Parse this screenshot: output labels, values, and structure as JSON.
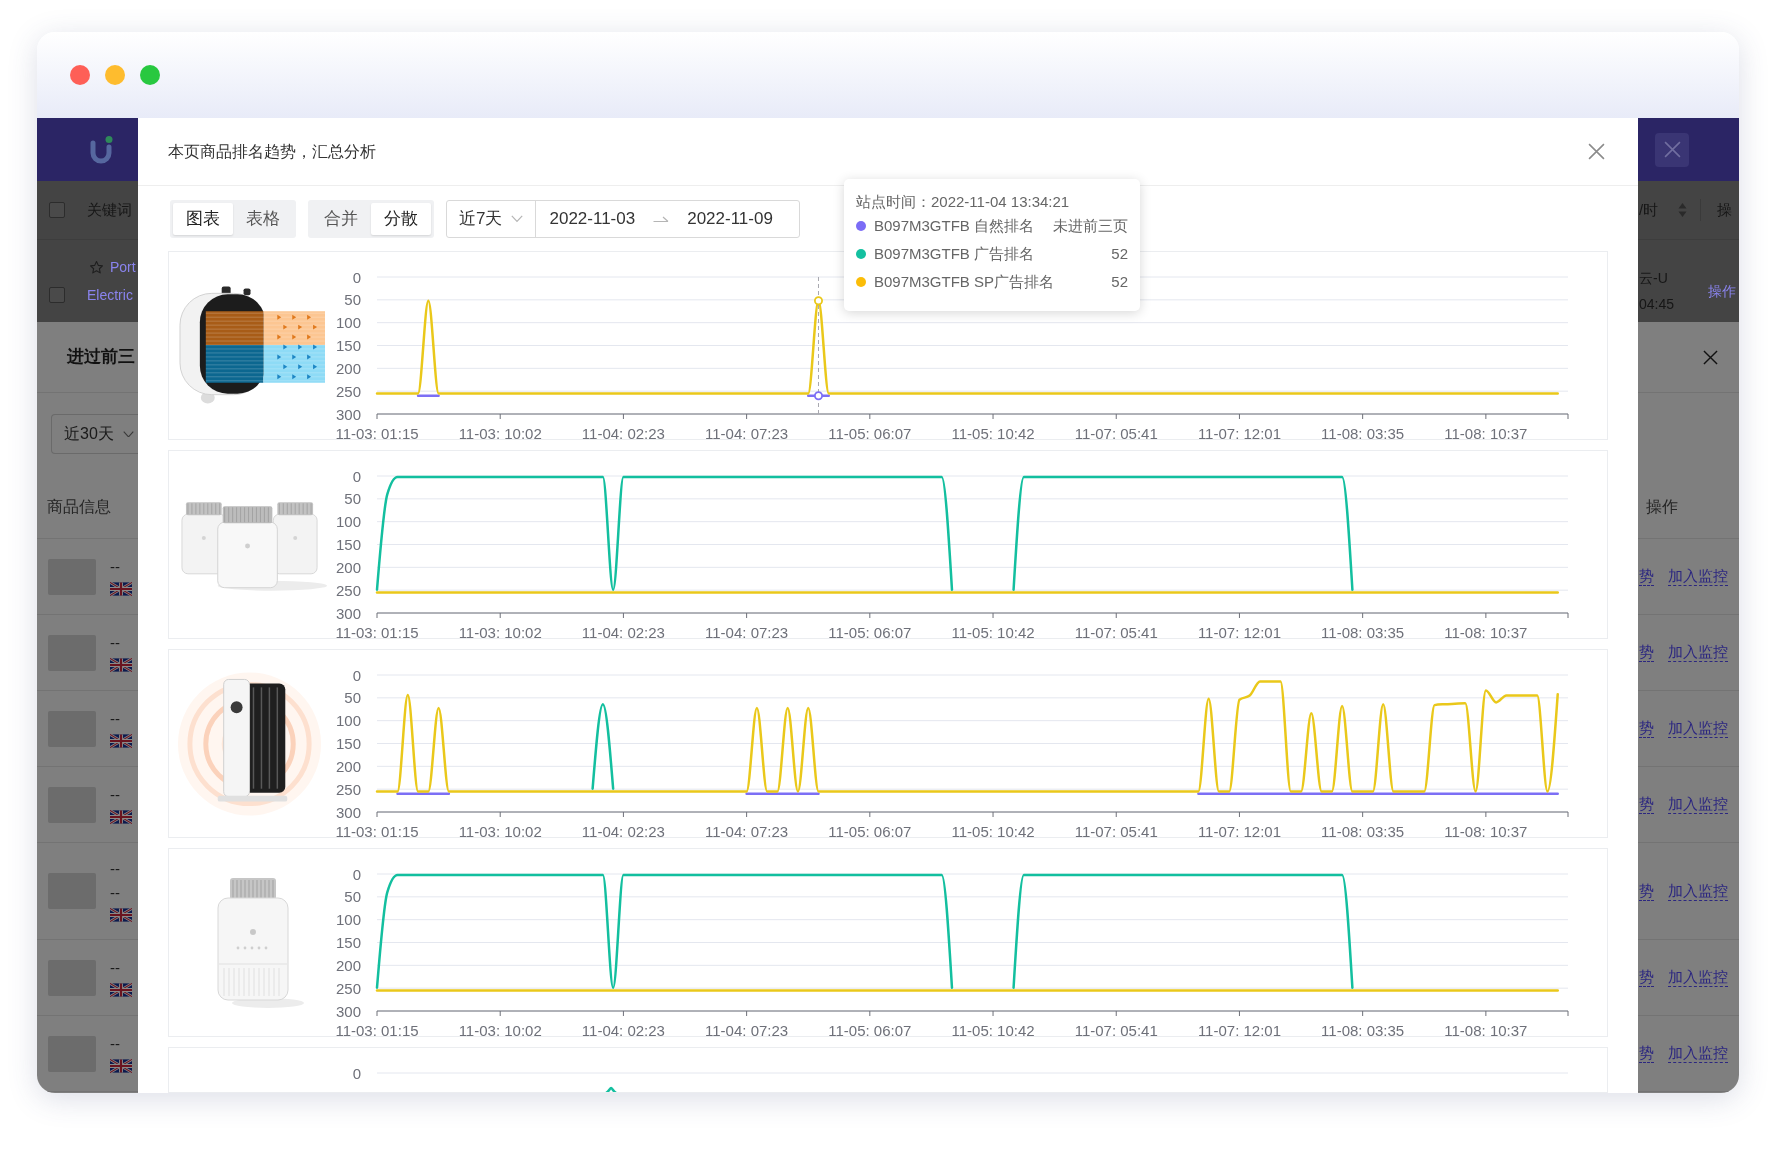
{
  "background": {
    "table_header": {
      "checked": false,
      "columns": [
        "关键词",
        "/时",
        "操"
      ]
    },
    "table_row": {
      "checked": false,
      "title_lines": [
        "Port",
        "Electric"
      ],
      "store": "云-U",
      "time": "04:45",
      "action": "操作"
    },
    "drawer": {
      "title": "进过前三",
      "range": "近30天",
      "columns": [
        "商品信息",
        "操作"
      ],
      "rows": [
        {
          "lines": [
            "--"
          ],
          "trend_link": "势",
          "monitor_link": "加入监控"
        },
        {
          "lines": [
            "--"
          ],
          "trend_link": "势",
          "monitor_link": "加入监控"
        },
        {
          "lines": [
            "--"
          ],
          "trend_link": "势",
          "monitor_link": "加入监控"
        },
        {
          "lines": [
            "--"
          ],
          "trend_link": "势",
          "monitor_link": "加入监控"
        },
        {
          "lines": [
            "--",
            "--"
          ],
          "trend_link": "势",
          "monitor_link": "加入监控"
        },
        {
          "lines": [
            "--"
          ],
          "trend_link": "势",
          "monitor_link": "加入监控"
        },
        {
          "lines": [
            "--"
          ],
          "trend_link": "势",
          "monitor_link": "加入监控"
        }
      ]
    }
  },
  "modal": {
    "title": "本页商品排名趋势，汇总分析",
    "view_tabs": [
      {
        "label": "图表",
        "selected": true
      },
      {
        "label": "表格",
        "selected": false
      }
    ],
    "mode_tabs": [
      {
        "label": "合并",
        "selected": false
      },
      {
        "label": "分散",
        "selected": true
      }
    ],
    "range_picker": {
      "preset": "近7天",
      "start": "2022-11-03",
      "end": "2022-11-09"
    },
    "tooltip": {
      "title": "站点时间：2022-11-04 13:34:21",
      "rows": [
        {
          "label": "B097M3GTFB 自然排名",
          "value": "未进前三页",
          "color": "#7b6cf6"
        },
        {
          "label": "B097M3GTFB 广告排名",
          "value": "52",
          "color": "#14c0a0"
        },
        {
          "label": "B097M3GTFB SP广告排名",
          "value": "52",
          "color": "#fbbd08"
        }
      ]
    },
    "charts": [
      {
        "kind": "chart",
        "chart_data": {
          "type": "line",
          "grid": true,
          "categories": [
            "11-03: 01:15",
            null,
            null,
            null,
            null,
            null,
            null,
            null,
            null,
            null,
            null,
            null,
            "11-03: 10:02",
            null,
            null,
            null,
            null,
            null,
            null,
            null,
            null,
            null,
            null,
            null,
            "11-04: 02:23",
            null,
            null,
            null,
            null,
            null,
            null,
            null,
            null,
            null,
            null,
            null,
            "11-04: 07:23",
            null,
            null,
            null,
            null,
            null,
            null,
            null,
            null,
            null,
            null,
            null,
            "11-05: 06:07",
            null,
            null,
            null,
            null,
            null,
            null,
            null,
            null,
            null,
            null,
            null,
            "11-05: 10:42",
            null,
            null,
            null,
            null,
            null,
            null,
            null,
            null,
            null,
            null,
            null,
            "11-07: 05:41",
            null,
            null,
            null,
            null,
            null,
            null,
            null,
            null,
            null,
            null,
            null,
            "11-07: 12:01",
            null,
            null,
            null,
            null,
            null,
            null,
            null,
            null,
            null,
            null,
            null,
            "11-08: 03:35",
            null,
            null,
            null,
            null,
            null,
            null,
            null,
            null,
            null,
            null,
            null,
            "11-08: 10:37",
            null,
            null,
            null,
            null,
            null,
            null,
            null,
            null
          ],
          "ylim": [
            300,
            0
          ],
          "yticks": [
            0,
            50,
            100,
            150,
            200,
            250,
            300
          ],
          "series": [
            {
              "color": "#7c6ff5",
              "values": [
                null,
                null,
                null,
                null,
                260,
                260,
                260,
                null,
                null,
                null,
                null,
                null,
                null,
                null,
                null,
                null,
                null,
                null,
                null,
                null,
                null,
                null,
                null,
                null,
                null,
                null,
                null,
                null,
                null,
                null,
                null,
                null,
                null,
                null,
                null,
                null,
                null,
                null,
                null,
                null,
                null,
                null,
                260,
                260,
                260,
                null,
                null,
                null,
                null,
                null,
                null,
                null,
                null,
                null,
                null,
                null,
                null,
                null,
                null,
                null,
                null,
                null,
                null,
                null,
                null,
                null,
                null,
                null,
                null,
                null,
                null,
                null,
                null,
                null,
                null,
                null,
                null,
                null,
                null,
                null,
                null,
                null,
                null,
                null,
                null,
                null,
                null,
                null,
                null,
                null,
                null,
                null,
                null,
                null,
                null,
                null,
                null,
                null,
                null,
                null,
                null,
                null,
                null,
                null,
                null,
                null,
                null,
                null,
                null,
                null,
                null,
                null,
                null,
                null,
                null,
                null,
                null
              ]
            },
            {
              "color": "#eac81a",
              "values": [
                255,
                255,
                255,
                255,
                255,
                52,
                255,
                255,
                255,
                255,
                255,
                255,
                255,
                255,
                255,
                255,
                255,
                255,
                255,
                255,
                255,
                255,
                255,
                255,
                255,
                255,
                255,
                255,
                255,
                255,
                255,
                255,
                255,
                255,
                255,
                255,
                255,
                255,
                255,
                255,
                255,
                255,
                255,
                52,
                255,
                255,
                255,
                255,
                255,
                255,
                255,
                255,
                255,
                255,
                255,
                255,
                255,
                255,
                255,
                255,
                255,
                255,
                255,
                255,
                255,
                255,
                255,
                255,
                255,
                255,
                255,
                255,
                255,
                255,
                255,
                255,
                255,
                255,
                255,
                255,
                255,
                255,
                255,
                255,
                255,
                255,
                255,
                255,
                255,
                255,
                255,
                255,
                255,
                255,
                255,
                255,
                255,
                255,
                255,
                255,
                255,
                255,
                255,
                255,
                255,
                255,
                255,
                255,
                255,
                255,
                255,
                255,
                255,
                255,
                255,
                255,
                null
              ]
            }
          ]
        }
      },
      {
        "kind": "chart",
        "chart_data": {
          "type": "line",
          "grid": true,
          "categories": [
            "11-03: 01:15",
            null,
            null,
            null,
            null,
            null,
            null,
            null,
            null,
            null,
            null,
            null,
            "11-03: 10:02",
            null,
            null,
            null,
            null,
            null,
            null,
            null,
            null,
            null,
            null,
            null,
            "11-04: 02:23",
            null,
            null,
            null,
            null,
            null,
            null,
            null,
            null,
            null,
            null,
            null,
            "11-04: 07:23",
            null,
            null,
            null,
            null,
            null,
            null,
            null,
            null,
            null,
            null,
            null,
            "11-05: 06:07",
            null,
            null,
            null,
            null,
            null,
            null,
            null,
            null,
            null,
            null,
            null,
            "11-05: 10:42",
            null,
            null,
            null,
            null,
            null,
            null,
            null,
            null,
            null,
            null,
            null,
            "11-07: 05:41",
            null,
            null,
            null,
            null,
            null,
            null,
            null,
            null,
            null,
            null,
            null,
            "11-07: 12:01",
            null,
            null,
            null,
            null,
            null,
            null,
            null,
            null,
            null,
            null,
            null,
            "11-08: 03:35",
            null,
            null,
            null,
            null,
            null,
            null,
            null,
            null,
            null,
            null,
            null,
            "11-08: 10:37",
            null,
            null,
            null,
            null,
            null,
            null,
            null,
            null
          ],
          "ylim": [
            300,
            0
          ],
          "yticks": [
            0,
            50,
            100,
            150,
            200,
            250,
            300
          ],
          "series": [
            {
              "color": "#13bf9f",
              "values": [
                249,
                40,
                2,
                2,
                2,
                2,
                2,
                2,
                2,
                2,
                2,
                2,
                2,
                2,
                2,
                2,
                2,
                2,
                2,
                2,
                2,
                2,
                2,
                249,
                2,
                2,
                2,
                2,
                2,
                2,
                2,
                2,
                2,
                2,
                2,
                2,
                2,
                2,
                2,
                2,
                2,
                2,
                2,
                2,
                2,
                2,
                2,
                2,
                2,
                2,
                2,
                2,
                2,
                2,
                2,
                2,
                249,
                null,
                null,
                null,
                null,
                null,
                249,
                2,
                2,
                2,
                2,
                2,
                2,
                2,
                2,
                2,
                2,
                2,
                2,
                2,
                2,
                2,
                2,
                2,
                2,
                2,
                2,
                2,
                2,
                2,
                2,
                2,
                2,
                2,
                2,
                2,
                2,
                2,
                2,
                249,
                null,
                null,
                null,
                null,
                null,
                null,
                null,
                null,
                null,
                null,
                null,
                null,
                null,
                null,
                null,
                null,
                null,
                null,
                null,
                null,
                null
              ]
            },
            {
              "color": "#eac81a",
              "values": [
                255,
                255,
                255,
                255,
                255,
                255,
                255,
                255,
                255,
                255,
                255,
                255,
                255,
                255,
                255,
                255,
                255,
                255,
                255,
                255,
                255,
                255,
                255,
                255,
                255,
                255,
                255,
                255,
                255,
                255,
                255,
                255,
                255,
                255,
                255,
                255,
                255,
                255,
                255,
                255,
                255,
                255,
                255,
                255,
                255,
                255,
                255,
                255,
                255,
                255,
                255,
                255,
                255,
                255,
                255,
                255,
                255,
                255,
                255,
                255,
                255,
                255,
                255,
                255,
                255,
                255,
                255,
                255,
                255,
                255,
                255,
                255,
                255,
                255,
                255,
                255,
                255,
                255,
                255,
                255,
                255,
                255,
                255,
                255,
                255,
                255,
                255,
                255,
                255,
                255,
                255,
                255,
                255,
                255,
                255,
                255,
                255,
                255,
                255,
                255,
                255,
                255,
                255,
                255,
                255,
                255,
                255,
                255,
                255,
                255,
                255,
                255,
                255,
                255,
                255,
                255,
                null
              ]
            }
          ]
        }
      },
      {
        "kind": "chart",
        "chart_data": {
          "type": "line",
          "grid": true,
          "categories": [
            "11-03: 01:15",
            null,
            null,
            null,
            null,
            null,
            null,
            null,
            null,
            null,
            null,
            null,
            "11-03: 10:02",
            null,
            null,
            null,
            null,
            null,
            null,
            null,
            null,
            null,
            null,
            null,
            "11-04: 02:23",
            null,
            null,
            null,
            null,
            null,
            null,
            null,
            null,
            null,
            null,
            null,
            "11-04: 07:23",
            null,
            null,
            null,
            null,
            null,
            null,
            null,
            null,
            null,
            null,
            null,
            "11-05: 06:07",
            null,
            null,
            null,
            null,
            null,
            null,
            null,
            null,
            null,
            null,
            null,
            "11-05: 10:42",
            null,
            null,
            null,
            null,
            null,
            null,
            null,
            null,
            null,
            null,
            null,
            "11-07: 05:41",
            null,
            null,
            null,
            null,
            null,
            null,
            null,
            null,
            null,
            null,
            null,
            "11-07: 12:01",
            null,
            null,
            null,
            null,
            null,
            null,
            null,
            null,
            null,
            null,
            null,
            "11-08: 03:35",
            null,
            null,
            null,
            null,
            null,
            null,
            null,
            null,
            null,
            null,
            null,
            "11-08: 10:37",
            null,
            null,
            null,
            null,
            null,
            null,
            null,
            null
          ],
          "ylim": [
            300,
            0
          ],
          "yticks": [
            0,
            50,
            100,
            150,
            200,
            250,
            300
          ],
          "series": [
            {
              "color": "#7c6ff5",
              "values": [
                null,
                null,
                260,
                260,
                260,
                260,
                260,
                260,
                null,
                null,
                null,
                null,
                null,
                null,
                null,
                null,
                null,
                null,
                null,
                null,
                null,
                null,
                null,
                null,
                null,
                null,
                null,
                null,
                null,
                null,
                null,
                null,
                null,
                null,
                null,
                null,
                260,
                260,
                260,
                260,
                260,
                260,
                260,
                260,
                null,
                null,
                null,
                null,
                null,
                null,
                null,
                null,
                null,
                null,
                null,
                null,
                null,
                null,
                null,
                null,
                null,
                null,
                null,
                null,
                null,
                null,
                null,
                null,
                null,
                null,
                null,
                null,
                null,
                null,
                null,
                null,
                null,
                null,
                null,
                null,
                260,
                260,
                260,
                260,
                260,
                260,
                260,
                260,
                260,
                260,
                260,
                260,
                260,
                260,
                260,
                260,
                260,
                260,
                260,
                260,
                260,
                260,
                260,
                260,
                260,
                260,
                260,
                260,
                260,
                260,
                260,
                260,
                260,
                260,
                260,
                260,
                null
              ]
            },
            {
              "color": "#13bf9f",
              "values": [
                null,
                null,
                null,
                null,
                null,
                null,
                null,
                null,
                null,
                null,
                null,
                null,
                null,
                null,
                null,
                null,
                null,
                null,
                null,
                null,
                null,
                249,
                64,
                249,
                null,
                null,
                null,
                null,
                null,
                null,
                null,
                null,
                null,
                null,
                null,
                null,
                null,
                null,
                null,
                null,
                null,
                null,
                null,
                null,
                null,
                null,
                null,
                null,
                null,
                null,
                null,
                null,
                null,
                null,
                null,
                null,
                null,
                null,
                null,
                null,
                null,
                null,
                null,
                null,
                null,
                null,
                null,
                null,
                null,
                null,
                null,
                null,
                null,
                null,
                null,
                null,
                null,
                null,
                null,
                null,
                null,
                null,
                null,
                null,
                null,
                null,
                null,
                null,
                null,
                null,
                null,
                null,
                null,
                null,
                null,
                null,
                null,
                null,
                null,
                null,
                null,
                null,
                null,
                null,
                null,
                null,
                null,
                null,
                null,
                null,
                null,
                null,
                null,
                null,
                null,
                null,
                null
              ]
            },
            {
              "color": "#eac81a",
              "values": [
                255,
                255,
                255,
                44,
                255,
                255,
                72,
                255,
                255,
                255,
                255,
                255,
                255,
                255,
                255,
                255,
                255,
                255,
                255,
                255,
                255,
                255,
                255,
                255,
                255,
                255,
                255,
                255,
                255,
                255,
                255,
                255,
                255,
                255,
                255,
                255,
                255,
                72,
                255,
                255,
                72,
                255,
                72,
                255,
                255,
                255,
                255,
                255,
                255,
                255,
                255,
                255,
                255,
                255,
                255,
                255,
                255,
                255,
                255,
                255,
                255,
                255,
                255,
                255,
                255,
                255,
                255,
                255,
                255,
                255,
                255,
                255,
                255,
                255,
                255,
                255,
                255,
                255,
                255,
                255,
                255,
                52,
                255,
                255,
                54,
                45,
                14,
                14,
                14,
                255,
                255,
                84,
                255,
                255,
                68,
                255,
                255,
                255,
                64,
                255,
                255,
                255,
                255,
                66,
                64,
                63,
                62,
                255,
                34,
                60,
                45,
                45,
                45,
                45,
                255,
                42,
                null
              ]
            }
          ]
        }
      },
      {
        "kind": "chart",
        "chart_data": {
          "type": "line",
          "grid": true,
          "categories": [
            "11-03: 01:15",
            null,
            null,
            null,
            null,
            null,
            null,
            null,
            null,
            null,
            null,
            null,
            "11-03: 10:02",
            null,
            null,
            null,
            null,
            null,
            null,
            null,
            null,
            null,
            null,
            null,
            "11-04: 02:23",
            null,
            null,
            null,
            null,
            null,
            null,
            null,
            null,
            null,
            null,
            null,
            "11-04: 07:23",
            null,
            null,
            null,
            null,
            null,
            null,
            null,
            null,
            null,
            null,
            null,
            "11-05: 06:07",
            null,
            null,
            null,
            null,
            null,
            null,
            null,
            null,
            null,
            null,
            null,
            "11-05: 10:42",
            null,
            null,
            null,
            null,
            null,
            null,
            null,
            null,
            null,
            null,
            null,
            "11-07: 05:41",
            null,
            null,
            null,
            null,
            null,
            null,
            null,
            null,
            null,
            null,
            null,
            "11-07: 12:01",
            null,
            null,
            null,
            null,
            null,
            null,
            null,
            null,
            null,
            null,
            null,
            "11-08: 03:35",
            null,
            null,
            null,
            null,
            null,
            null,
            null,
            null,
            null,
            null,
            null,
            "11-08: 10:37",
            null,
            null,
            null,
            null,
            null,
            null,
            null,
            null
          ],
          "ylim": [
            300,
            0
          ],
          "yticks": [
            0,
            50,
            100,
            150,
            200,
            250,
            300
          ],
          "series": [
            {
              "color": "#13bf9f",
              "values": [
                249,
                40,
                2,
                2,
                2,
                2,
                2,
                2,
                2,
                2,
                2,
                2,
                2,
                2,
                2,
                2,
                2,
                2,
                2,
                2,
                2,
                2,
                2,
                249,
                2,
                2,
                2,
                2,
                2,
                2,
                2,
                2,
                2,
                2,
                2,
                2,
                2,
                2,
                2,
                2,
                2,
                2,
                2,
                2,
                2,
                2,
                2,
                2,
                2,
                2,
                2,
                2,
                2,
                2,
                2,
                2,
                249,
                null,
                null,
                null,
                null,
                null,
                249,
                2,
                2,
                2,
                2,
                2,
                2,
                2,
                2,
                2,
                2,
                2,
                2,
                2,
                2,
                2,
                2,
                2,
                2,
                2,
                2,
                2,
                2,
                2,
                2,
                2,
                2,
                2,
                2,
                2,
                2,
                2,
                2,
                249,
                null,
                null,
                null,
                null,
                null,
                null,
                null,
                null,
                null,
                null,
                null,
                null,
                null,
                null,
                null,
                null,
                null,
                null,
                null,
                null,
                null
              ]
            },
            {
              "color": "#eac81a",
              "values": [
                255,
                255,
                255,
                255,
                255,
                255,
                255,
                255,
                255,
                255,
                255,
                255,
                255,
                255,
                255,
                255,
                255,
                255,
                255,
                255,
                255,
                255,
                255,
                255,
                255,
                255,
                255,
                255,
                255,
                255,
                255,
                255,
                255,
                255,
                255,
                255,
                255,
                255,
                255,
                255,
                255,
                255,
                255,
                255,
                255,
                255,
                255,
                255,
                255,
                255,
                255,
                255,
                255,
                255,
                255,
                255,
                255,
                255,
                255,
                255,
                255,
                255,
                255,
                255,
                255,
                255,
                255,
                255,
                255,
                255,
                255,
                255,
                255,
                255,
                255,
                255,
                255,
                255,
                255,
                255,
                255,
                255,
                255,
                255,
                255,
                255,
                255,
                255,
                255,
                255,
                255,
                255,
                255,
                255,
                255,
                255,
                255,
                255,
                255,
                255,
                255,
                255,
                255,
                255,
                255,
                255,
                255,
                255,
                255,
                255,
                255,
                255,
                255,
                255,
                255,
                255,
                null
              ]
            }
          ]
        }
      },
      {
        "kind": "partial",
        "axis_label": "0"
      }
    ]
  }
}
